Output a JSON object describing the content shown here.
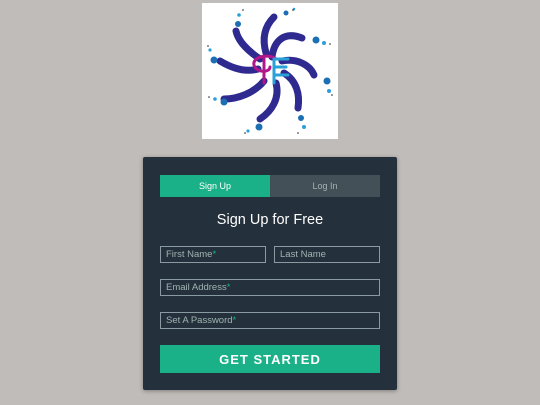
{
  "tabs": {
    "signup": "Sign Up",
    "login": "Log In"
  },
  "form": {
    "title": "Sign Up for Free",
    "first_name_placeholder": "First Name",
    "last_name_placeholder": "Last Name",
    "email_placeholder": "Email Address",
    "password_placeholder": "Set A Password",
    "required_marker": "*",
    "submit_label": "GET STARTED"
  },
  "colors": {
    "page_bg": "#c0bcb9",
    "card_bg": "#24313c",
    "accent": "#1ab188",
    "inactive_tab": "#435058",
    "muted_text": "#a0b3b0"
  },
  "logo": {
    "icon": "swirl-logo"
  }
}
